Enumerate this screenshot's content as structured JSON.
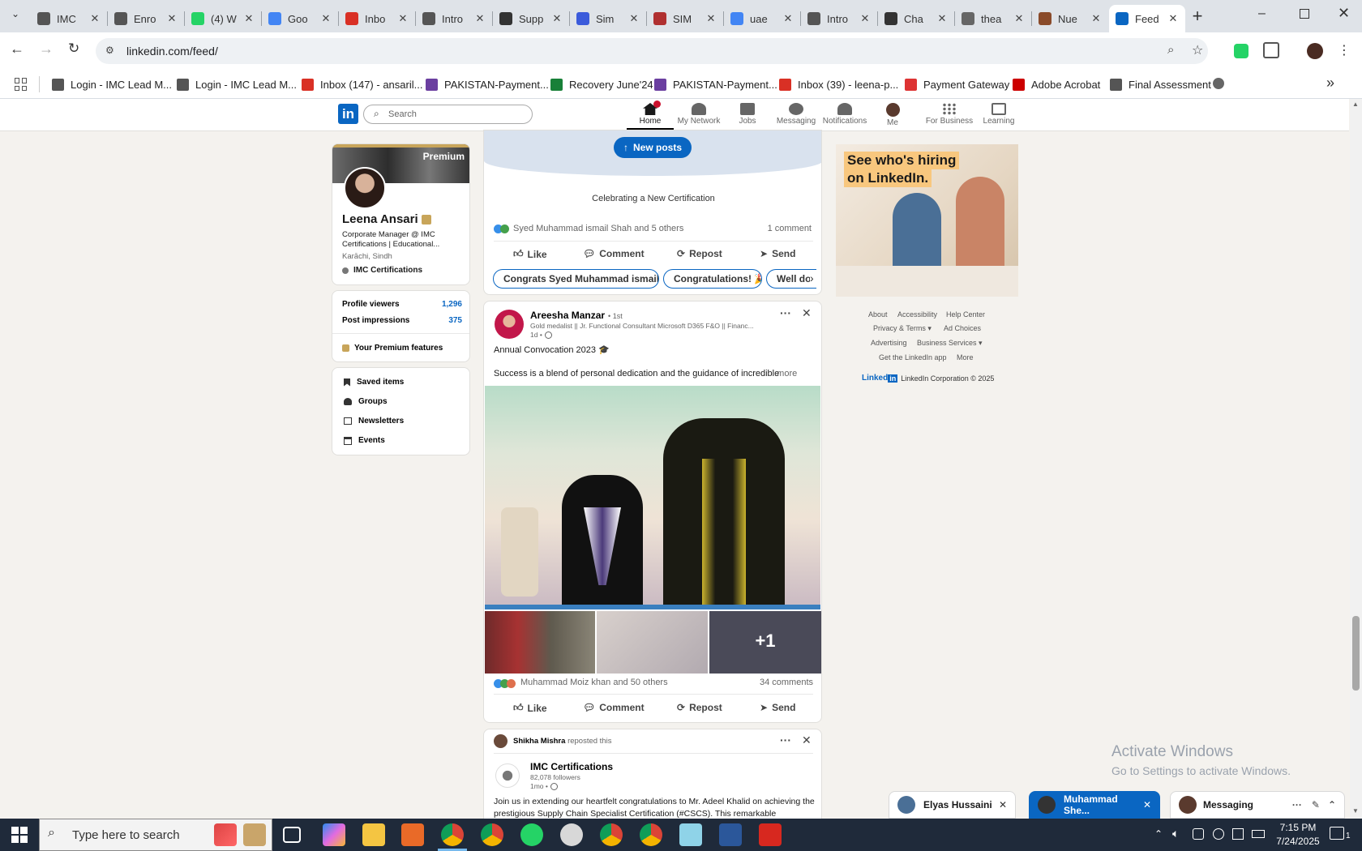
{
  "browser": {
    "tabs": [
      {
        "label": "IMC",
        "color": "#555"
      },
      {
        "label": "Enro",
        "color": "#555"
      },
      {
        "label": "(4) W",
        "color": "#25d366"
      },
      {
        "label": "Goo",
        "color": "#4285f4"
      },
      {
        "label": "Inbo",
        "color": "#d93025"
      },
      {
        "label": "Intro",
        "color": "#555"
      },
      {
        "label": "Supp",
        "color": "#333"
      },
      {
        "label": "Sim",
        "color": "#3b5bdb"
      },
      {
        "label": "SIM",
        "color": "#b03030"
      },
      {
        "label": "uae",
        "color": "#4285f4"
      },
      {
        "label": "Intro",
        "color": "#555"
      },
      {
        "label": "Cha",
        "color": "#333"
      },
      {
        "label": "thea",
        "color": "#666"
      },
      {
        "label": "Nue",
        "color": "#8a4b2a"
      },
      {
        "label": "Feed",
        "color": "#0a66c2"
      }
    ],
    "url": "linkedin.com/feed/",
    "bookmarks": [
      {
        "label": "Login - IMC Lead M...",
        "color": "#555"
      },
      {
        "label": "Login - IMC Lead M...",
        "color": "#555"
      },
      {
        "label": "Inbox (147) - ansaril...",
        "color": "#d93025"
      },
      {
        "label": "PAKISTAN-Payment...",
        "color": "#6b3fa0"
      },
      {
        "label": "Recovery June'24",
        "color": "#188038"
      },
      {
        "label": "PAKISTAN-Payment...",
        "color": "#6b3fa0"
      },
      {
        "label": "Inbox (39) - leena-p...",
        "color": "#d93025"
      },
      {
        "label": "Payment Gateway",
        "color": "#d33"
      },
      {
        "label": "Adobe Acrobat",
        "color": "#c00"
      },
      {
        "label": "Final Assessment",
        "color": "#555"
      }
    ]
  },
  "linkedin": {
    "logo": "in",
    "search_placeholder": "Search",
    "nav": [
      {
        "label": "Home",
        "icon": "home-icon"
      },
      {
        "label": "My Network",
        "icon": "network-icon"
      },
      {
        "label": "Jobs",
        "icon": "jobs-icon"
      },
      {
        "label": "Messaging",
        "icon": "messaging-icon"
      },
      {
        "label": "Notifications",
        "icon": "notifications-icon"
      },
      {
        "label": "Me",
        "icon": "avatar"
      },
      {
        "label": "For Business",
        "icon": "grid-icon"
      },
      {
        "label": "Learning",
        "icon": "learning-icon"
      }
    ]
  },
  "profile": {
    "badge": "Premium",
    "name": "Leena Ansari",
    "headline": "Corporate Manager @ IMC Certifications | Educational...",
    "location": "Karāchi, Sindh",
    "company": "IMC Certifications",
    "stats": [
      {
        "label": "Profile viewers",
        "value": "1,296"
      },
      {
        "label": "Post impressions",
        "value": "375"
      }
    ],
    "premium_features": "Your Premium features",
    "links": [
      "Saved items",
      "Groups",
      "Newsletters",
      "Events"
    ]
  },
  "feed": {
    "new_posts": "New posts",
    "post1": {
      "caption": "Celebrating a New Certification",
      "reactions": "Syed Muhammad ismail Shah and 5 others",
      "comments": "1 comment",
      "chips": [
        "Congrats Syed Muhammad ismail! 🎉",
        "Congratulations! 🎉",
        "Well do"
      ]
    },
    "actions": [
      "Like",
      "Comment",
      "Repost",
      "Send"
    ],
    "post2": {
      "author": "Areesha Manzar",
      "degree": "• 1st",
      "subtitle": "Gold medalist || Jr. Functional Consultant Microsoft D365 F&O || Financ...",
      "time": "1d •",
      "line1": "Annual Convocation 2023 🎓",
      "line2": "Success is a blend of personal dedication and the guidance of incredible",
      "more": "...more",
      "plus_count": "+1",
      "reactions": "Muhammad Moiz khan and 50 others",
      "comments": "34 comments"
    },
    "post3": {
      "reposter": "Shikha Mishra",
      "reposted": "reposted this",
      "org": "IMC Certifications",
      "followers": "82,078 followers",
      "time": "1mo •",
      "text": "Join us in extending our heartfelt congratulations to Mr. Adeel Khalid on achieving the prestigious Supply Chain Specialist Certification (#CSCS). This remarkable"
    }
  },
  "ad": {
    "line1": "See who's hiring",
    "line2": "on LinkedIn."
  },
  "footer": {
    "links": [
      "About",
      "Accessibility",
      "Help Center",
      "Privacy & Terms ▾",
      "Ad Choices",
      "Advertising",
      "Business Services ▾",
      "Get the LinkedIn app",
      "More"
    ],
    "brand": "Linked",
    "copyright": "LinkedIn Corporation © 2025"
  },
  "messaging": {
    "tabs": [
      "Elyas Hussaini",
      "Muhammad She...",
      "Messaging"
    ]
  },
  "watermark": {
    "line1": "Activate Windows",
    "line2": "Go to Settings to activate Windows."
  },
  "taskbar": {
    "search_placeholder": "Type here to search",
    "time": "7:15 PM",
    "date": "7/24/2025",
    "notification_count": "1"
  }
}
